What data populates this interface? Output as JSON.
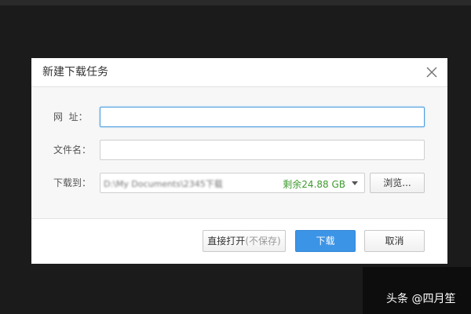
{
  "dialog": {
    "title": "新建下载任务",
    "close_icon": "close-icon"
  },
  "form": {
    "url_label": "网  址：",
    "url_value": "",
    "filename_label": "文件名：",
    "filename_value": "",
    "saveto_label": "下载到：",
    "saveto_path": "D:\\My Documents\\2345下载",
    "free_space": "剩余24.88 GB",
    "browse_label": "浏览..."
  },
  "footer": {
    "open_direct_label": "直接打开",
    "open_direct_hint": "(不保存)",
    "download_label": "下载",
    "cancel_label": "取消"
  },
  "watermark": {
    "text": "头条 @四月笙"
  },
  "colors": {
    "primary": "#3c94e6",
    "free_space": "#3f9a2e",
    "focus_border": "#4d9de0",
    "backdrop": "#1b1b1b"
  }
}
